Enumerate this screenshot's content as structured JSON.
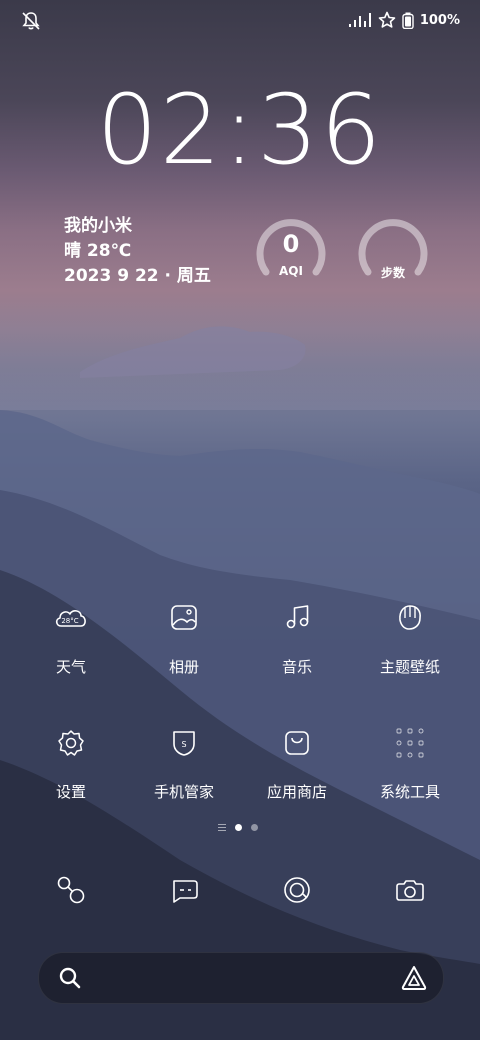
{
  "status_bar": {
    "left_icon": "bell-muted-icon",
    "signal_icon": "signal-icon",
    "star_icon": "star-icon",
    "battery_icon": "battery-icon",
    "battery_text": "100%"
  },
  "clock": {
    "time": "02:36"
  },
  "info": {
    "name": "我的小米",
    "weather": "晴 28℃",
    "date": "2023 9 22 · 周五"
  },
  "widgets": {
    "aqi": {
      "value": "0",
      "label": "AQI"
    },
    "steps": {
      "label": "步数"
    }
  },
  "apps": [
    {
      "label": "天气",
      "icon": "weather-icon",
      "badge": "28°C"
    },
    {
      "label": "相册",
      "icon": "gallery-icon"
    },
    {
      "label": "音乐",
      "icon": "music-icon"
    },
    {
      "label": "主题壁纸",
      "icon": "theme-icon"
    },
    {
      "label": "设置",
      "icon": "settings-icon"
    },
    {
      "label": "手机管家",
      "icon": "security-icon",
      "badge": "S"
    },
    {
      "label": "应用商店",
      "icon": "app-store-icon"
    },
    {
      "label": "系统工具",
      "icon": "folder-icon"
    }
  ],
  "page_indicator": {
    "pages": 2,
    "active": 0
  },
  "dock": [
    {
      "icon": "phone-icon"
    },
    {
      "icon": "messages-icon"
    },
    {
      "icon": "browser-icon"
    },
    {
      "icon": "camera-icon"
    }
  ],
  "search_bar": {
    "search_icon": "search-icon",
    "assistant_icon": "assistant-icon"
  },
  "colors": {
    "text": "#ffffff",
    "accent_sky": "#9c7d8e",
    "mountain_dark": "#2b3045"
  }
}
